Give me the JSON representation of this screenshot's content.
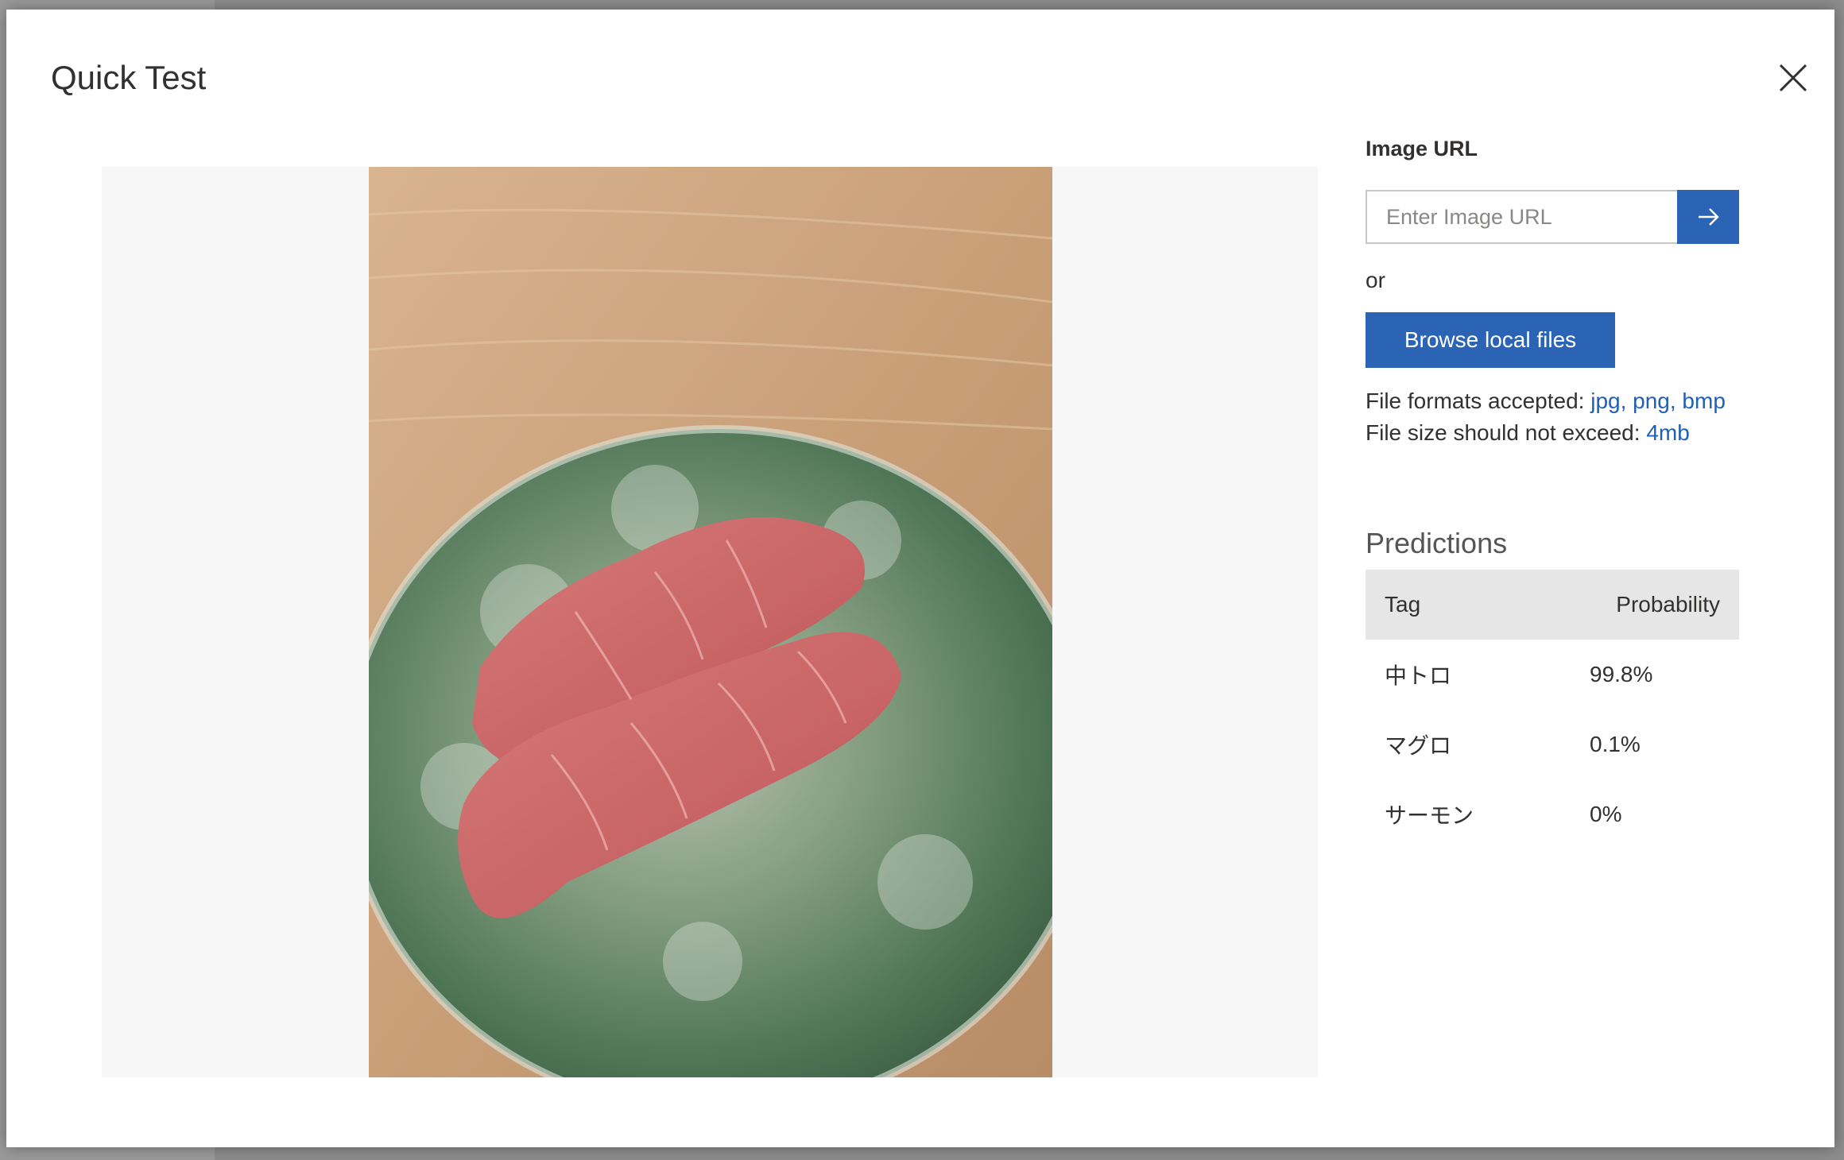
{
  "dialog": {
    "title": "Quick Test",
    "close_icon": "close-icon"
  },
  "image_url": {
    "label": "Image URL",
    "placeholder": "Enter Image URL",
    "submit_icon": "arrow-right-icon"
  },
  "or_text": "or",
  "browse_label": "Browse local files",
  "file_info": {
    "formats_label": "File formats accepted:",
    "formats_value": "jpg, png, bmp",
    "size_label": "File size should not exceed:",
    "size_value": "4mb"
  },
  "predictions": {
    "title": "Predictions",
    "headers": {
      "tag": "Tag",
      "probability": "Probability"
    },
    "rows": [
      {
        "tag": "中トロ",
        "probability": "99.8%"
      },
      {
        "tag": "マグロ",
        "probability": "0.1%"
      },
      {
        "tag": "サーモン",
        "probability": "0%"
      }
    ]
  },
  "colors": {
    "accent": "#2b63b5",
    "link": "#1f5fb4",
    "table_header_bg": "#e6e6e6"
  }
}
